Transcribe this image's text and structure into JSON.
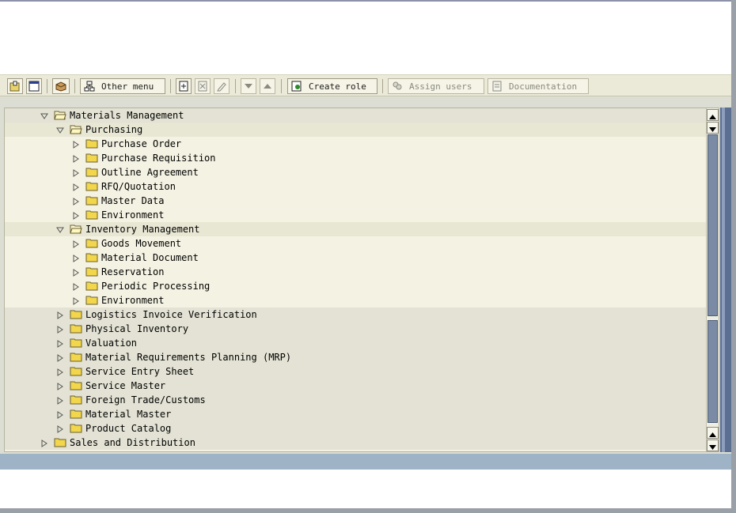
{
  "toolbar": {
    "other_menu_label": "Other menu",
    "create_role_label": "Create role",
    "assign_users_label": "Assign users",
    "documentation_label": "Documentation"
  },
  "tree": {
    "materials_management": "Materials Management",
    "purchasing": "Purchasing",
    "purchase_order": "Purchase Order",
    "purchase_requisition": "Purchase Requisition",
    "outline_agreement": "Outline Agreement",
    "rfq_quotation": "RFQ/Quotation",
    "master_data": "Master Data",
    "environment_purchasing": "Environment",
    "inventory_management": "Inventory Management",
    "goods_movement": "Goods Movement",
    "material_document": "Material Document",
    "reservation": "Reservation",
    "periodic_processing": "Periodic Processing",
    "environment_inventory": "Environment",
    "logistics_invoice_verification": "Logistics Invoice Verification",
    "physical_inventory": "Physical Inventory",
    "valuation": "Valuation",
    "mrp": "Material Requirements Planning (MRP)",
    "service_entry_sheet": "Service Entry Sheet",
    "service_master": "Service Master",
    "foreign_trade_customs": "Foreign Trade/Customs",
    "material_master": "Material Master",
    "product_catalog": "Product Catalog",
    "sales_and_distribution": "Sales and Distribution"
  },
  "colors": {
    "toolbar_bg": "#ebe9d8",
    "tree_bg": "#f4f2e2",
    "folder": "#f2d64b",
    "scroll_thumb": "#7b8ba5",
    "status_bar": "#9fb3c6"
  }
}
